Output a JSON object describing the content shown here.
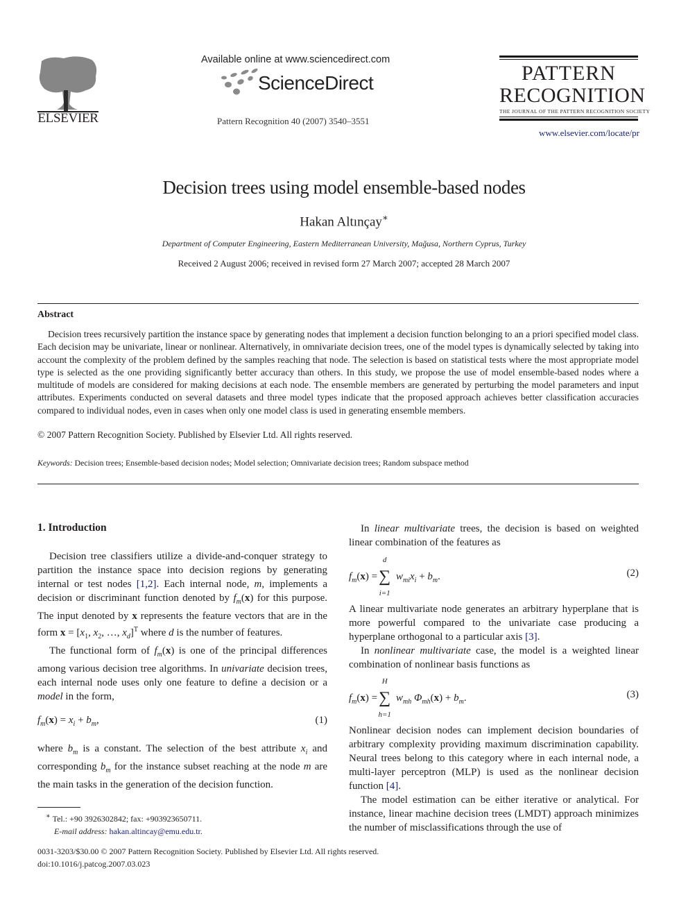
{
  "header": {
    "publisher_wordmark": "ELSEVIER",
    "available_online": "Available online at www.sciencedirect.com",
    "sciencedirect_wordmark": "ScienceDirect",
    "journal_reference": "Pattern Recognition 40 (2007) 3540–3551",
    "journal_title_line1": "PATTERN",
    "journal_title_line2": "RECOGNITION",
    "journal_subtitle": "THE JOURNAL OF THE PATTERN RECOGNITION SOCIETY",
    "journal_url": "www.elsevier.com/locate/pr"
  },
  "article": {
    "title": "Decision trees using model ensemble-based nodes",
    "author": "Hakan Altınçay",
    "author_mark": "∗",
    "affiliation": "Department of Computer Engineering, Eastern Mediterranean University, Mağusa, Northern Cyprus, Turkey",
    "dates": "Received 2 August 2006; received in revised form 27 March 2007; accepted 28 March 2007"
  },
  "abstract": {
    "heading": "Abstract",
    "body": "Decision trees recursively partition the instance space by generating nodes that implement a decision function belonging to an a priori specified model class. Each decision may be univariate, linear or nonlinear. Alternatively, in omnivariate decision trees, one of the model types is dynamically selected by taking into account the complexity of the problem defined by the samples reaching that node. The selection is based on statistical tests where the most appropriate model type is selected as the one providing significantly better accuracy than others. In this study, we propose the use of model ensemble-based nodes where a multitude of models are considered for making decisions at each node. The ensemble members are generated by perturbing the model parameters and input attributes. Experiments conducted on several datasets and three model types indicate that the proposed approach achieves better classification accuracies compared to individual nodes, even in cases when only one model class is used in generating ensemble members.",
    "copyright": "© 2007 Pattern Recognition Society. Published by Elsevier Ltd. All rights reserved.",
    "keywords_label": "Keywords:",
    "keywords": "Decision trees; Ensemble-based decision nodes; Model selection; Omnivariate decision trees; Random subspace method"
  },
  "left_column": {
    "section_heading": "1.  Introduction",
    "p1_a": "Decision tree classifiers utilize a divide-and-conquer strategy to partition the instance space into decision regions by generating internal or test nodes ",
    "p1_cite": "[1,2]",
    "p1_b": ". Each internal node, ",
    "p1_m": "m",
    "p1_c": ", implements a decision or discriminant function denoted by ",
    "p1_d": " for this purpose. The input denoted by ",
    "p1_e": " represents the feature vectors that are in the form ",
    "p1_f": " where ",
    "p1_d_var": "d",
    "p1_g": " is the number of features.",
    "p2_a": "The functional form of ",
    "p2_b": " is one of the principal differences among various decision tree algorithms. In ",
    "p2_univariate": "univariate",
    "p2_c": " decision trees, each internal node uses only one feature to define a decision or a ",
    "p2_model": "model",
    "p2_d": " in the form,",
    "eq1_num": "(1)",
    "p3_a": "where ",
    "p3_b": " is a constant. The selection of the best attribute ",
    "p3_c": " and corresponding ",
    "p3_d": " for the instance subset reaching at the node ",
    "p3_m": "m",
    "p3_e": " are the main tasks in the generation of the decision function."
  },
  "right_column": {
    "p1_a": "In ",
    "p1_em": "linear multivariate",
    "p1_b": " trees, the decision is based on weighted linear combination of the features as",
    "eq2_num": "(2)",
    "eq2_top": "d",
    "eq2_bot": "i=1",
    "p2_a": "A linear multivariate node generates an arbitrary hyperplane that is more powerful compared to the univariate case producing a hyperplane orthogonal to a particular axis ",
    "p2_cite": "[3]",
    "p2_b": ".",
    "p3_a": "In ",
    "p3_em": "nonlinear multivariate",
    "p3_b": " case, the model is a weighted linear combination of nonlinear basis functions as",
    "eq3_num": "(3)",
    "eq3_top": "H",
    "eq3_bot": "h=1",
    "p4_a": "Nonlinear decision nodes can implement decision boundaries of arbitrary complexity providing maximum discrimination capability. Neural trees belong to this category where in each internal node, a multi-layer perceptron (MLP) is used as the nonlinear decision function ",
    "p4_cite": "[4]",
    "p4_b": ".",
    "p5": "The model estimation can be either iterative or analytical. For instance, linear machine decision trees (LMDT) approach minimizes the number of misclassifications through the use of"
  },
  "footnote": {
    "mark": "∗",
    "contact": "Tel.: +90 3926302842; fax: +903923650711.",
    "email_label": "E-mail address:",
    "email": "hakan.altincay@emu.edu.tr",
    "email_end": "."
  },
  "footer": {
    "issn_line": "0031-3203/$30.00 © 2007 Pattern Recognition Society. Published by Elsevier Ltd. All rights reserved.",
    "doi": "doi:10.1016/j.patcog.2007.03.023"
  },
  "colors": {
    "link": "#1a237e",
    "text": "#231f20"
  }
}
